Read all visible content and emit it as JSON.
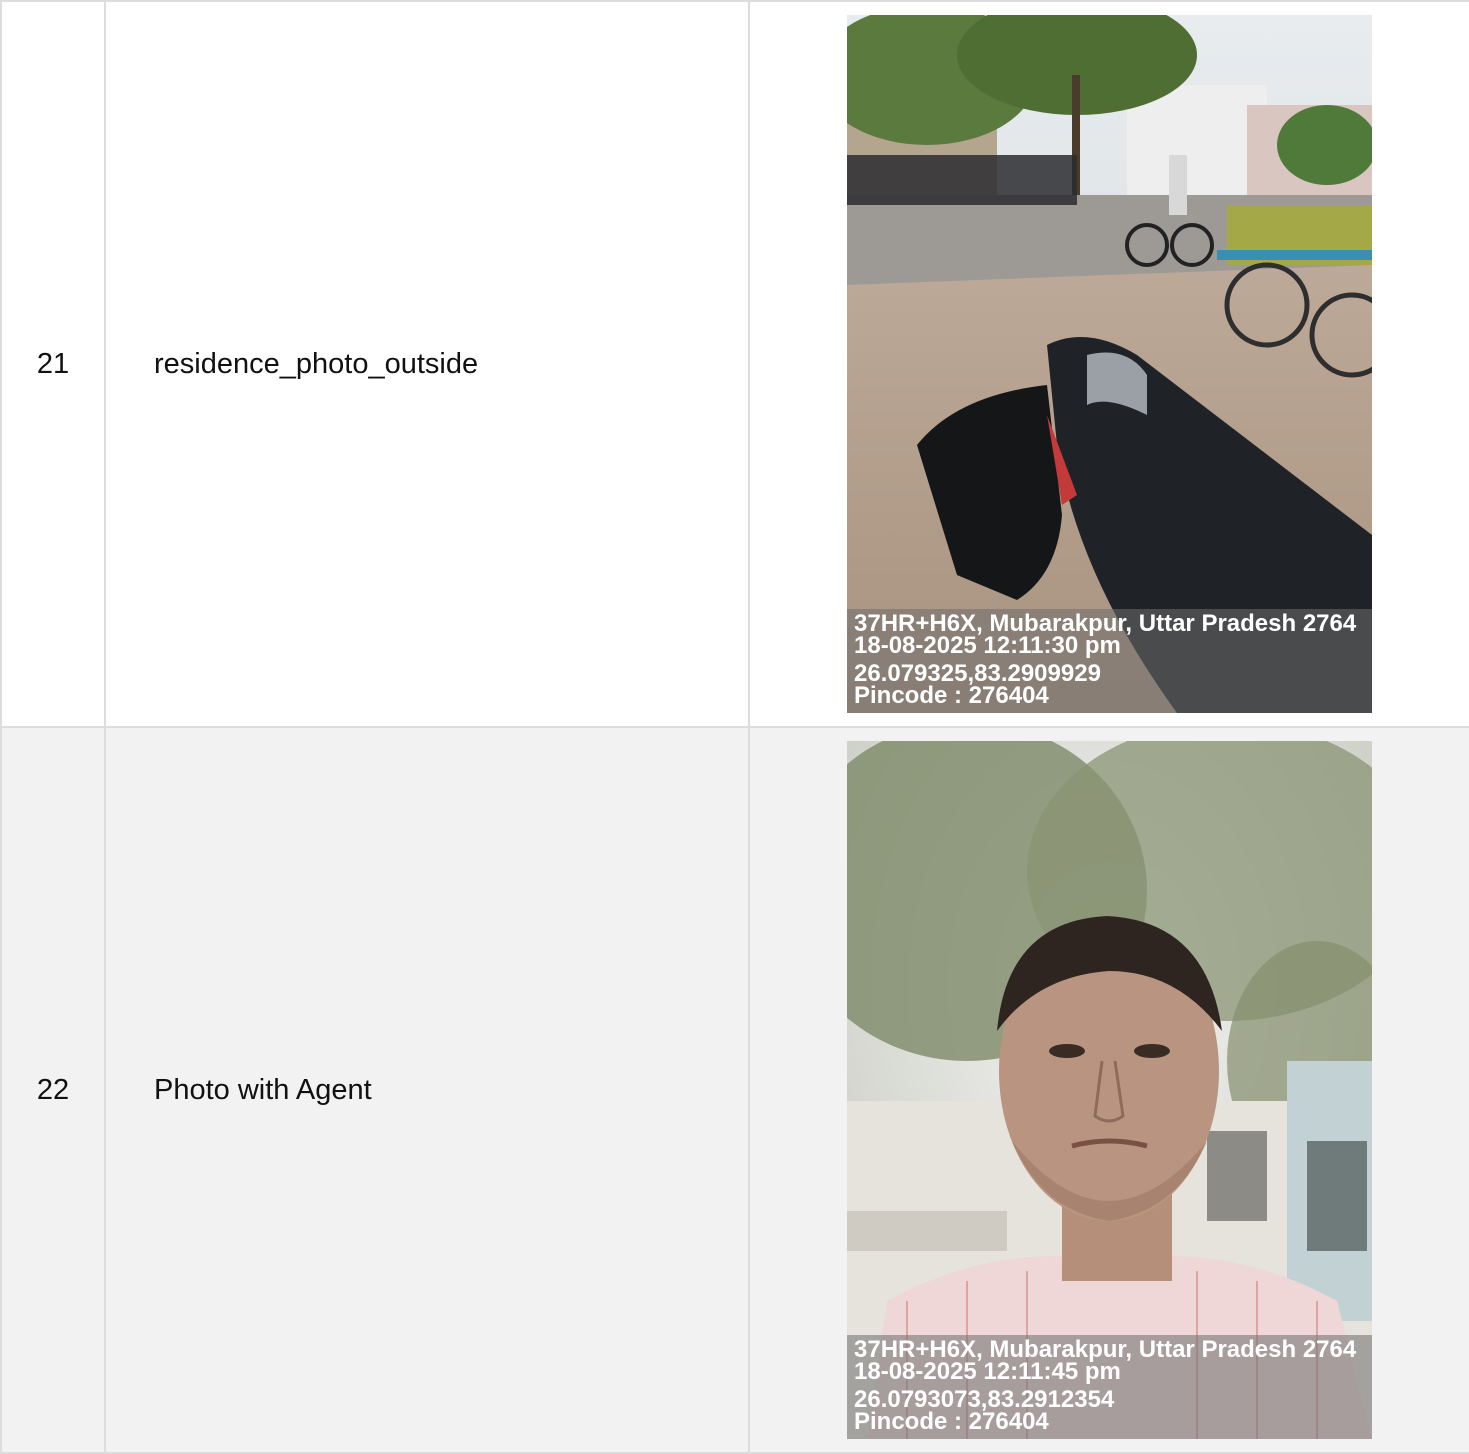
{
  "rows": [
    {
      "number": "21",
      "label": "residence_photo_outside",
      "photo": {
        "subject": "street scene with parked motorcycle",
        "stamp": {
          "address": "37HR+H6X, Mubarakpur, Uttar Pradesh 2764",
          "datetime": "18-08-2025 12:11:30 pm",
          "coordinates": "26.079325,83.2909929",
          "pincode": "Pincode : 276404"
        }
      }
    },
    {
      "number": "22",
      "label": "Photo with Agent",
      "photo": {
        "subject": "selfie of agent under tree",
        "stamp": {
          "address": "37HR+H6X, Mubarakpur, Uttar Pradesh 2764",
          "datetime": "18-08-2025 12:11:45 pm",
          "coordinates": "26.0793073,83.2912354",
          "pincode": "Pincode : 276404"
        }
      }
    }
  ]
}
